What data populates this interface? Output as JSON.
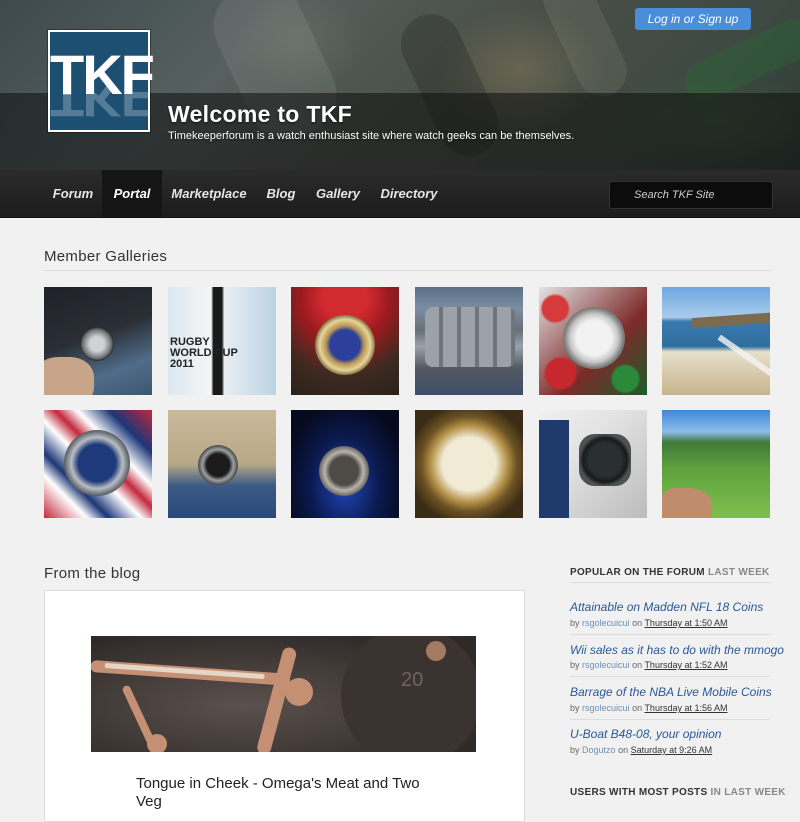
{
  "header": {
    "logo_text": "TKF",
    "title": "Welcome to TKF",
    "tagline": "Timekeeperforum is a watch enthusiast site where watch geeks can be themselves.",
    "login_label": "Log in or Sign up"
  },
  "nav": {
    "items": [
      {
        "label": "Forum",
        "active": false
      },
      {
        "label": "Portal",
        "active": true
      },
      {
        "label": "Marketplace",
        "active": false
      },
      {
        "label": "Blog",
        "active": false
      },
      {
        "label": "Gallery",
        "active": false
      },
      {
        "label": "Directory",
        "active": false
      }
    ],
    "search_placeholder": "Search TKF Site"
  },
  "galleries": {
    "title": "Member Galleries",
    "thumbs": [
      {
        "subject": "watch on wrist with jeans"
      },
      {
        "subject": "Rugby World Cup 2011 banner"
      },
      {
        "subject": "gold Yacht-Master on red flowers"
      },
      {
        "subject": "steel watch bracelet close-up"
      },
      {
        "subject": "Navitimer on Christmas ornaments"
      },
      {
        "subject": "beach coastline"
      },
      {
        "subject": "Seamaster on Union Jack"
      },
      {
        "subject": "diver watch on wrist"
      },
      {
        "subject": "Datejust on blue background"
      },
      {
        "subject": "Cartier Calibre dial"
      },
      {
        "subject": "black watch on wrist"
      },
      {
        "subject": "golf course"
      }
    ],
    "thumb_text": {
      "rugby_line1": "RUGBY",
      "rugby_line2": "WORLD CUP",
      "rugby_line3": "2011"
    }
  },
  "blog": {
    "title": "From the blog",
    "post_title": "Tongue in Cheek - Omega's Meat and Two Veg"
  },
  "sidebar": {
    "popular": {
      "heading": "POPULAR ON THE FORUM",
      "heading_muted": "LAST WEEK",
      "posts": [
        {
          "title": "Attainable on Madden NFL 18 Coins",
          "by": "by",
          "user": "rsgolecuicui",
          "on": "on",
          "date": "Thursday at 1:50 AM"
        },
        {
          "title": "Wii sales as it has to do with the mmogo",
          "by": "by",
          "user": "rsgolecuicui",
          "on": "on",
          "date": "Thursday at 1:52 AM"
        },
        {
          "title": "Barrage of the NBA Live Mobile Coins",
          "by": "by",
          "user": "rsgolecuicui",
          "on": "on",
          "date": "Thursday at 1:56 AM"
        },
        {
          "title": "U-Boat B48-08, your opinion",
          "by": "by",
          "user": "Dogutzo",
          "on": "on",
          "date": "Saturday at 9:26 AM"
        }
      ]
    },
    "most_posts": {
      "heading": "USERS WITH MOST POSTS",
      "heading_muted": "IN LAST WEEK"
    }
  }
}
